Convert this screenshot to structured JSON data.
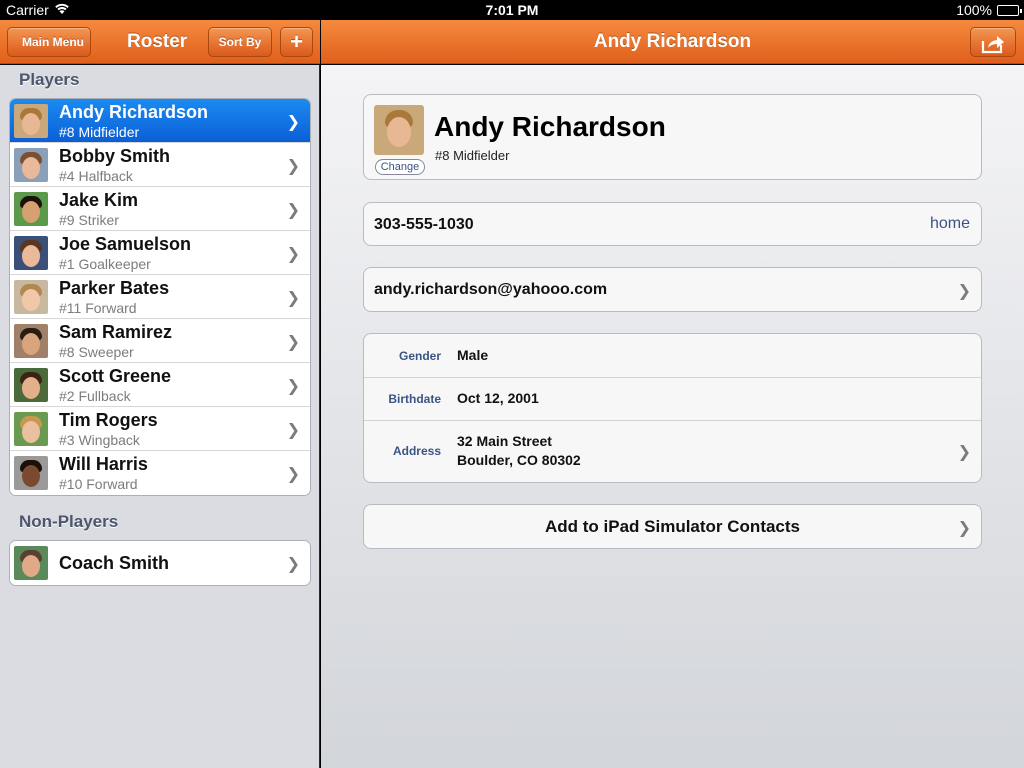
{
  "status_bar": {
    "carrier": "Carrier",
    "time": "7:01 PM",
    "battery": "100%"
  },
  "left_nav": {
    "back_label": "Main Menu",
    "title": "Roster",
    "sort_label": "Sort By",
    "add_label": "+"
  },
  "right_nav": {
    "title": "Andy Richardson",
    "share_icon": "share-icon"
  },
  "sidebar": {
    "players_header": "Players",
    "players": [
      {
        "name": "Andy Richardson",
        "detail": "#8 Midfielder",
        "selected": true,
        "skin": "#e8b895",
        "hair": "#a8793a",
        "bg": "#c9a87a"
      },
      {
        "name": "Bobby Smith",
        "detail": "#4 Halfback",
        "skin": "#eab99a",
        "hair": "#7a5030",
        "bg": "#8aa0b8"
      },
      {
        "name": "Jake Kim",
        "detail": "#9 Striker",
        "skin": "#d6a070",
        "hair": "#1c1208",
        "bg": "#5a9a4a"
      },
      {
        "name": "Joe Samuelson",
        "detail": "#1 Goalkeeper",
        "skin": "#eab99a",
        "hair": "#5a3620",
        "bg": "#3a5078"
      },
      {
        "name": "Parker Bates",
        "detail": "#11 Forward",
        "skin": "#f0c8a8",
        "hair": "#b08850",
        "bg": "#c8b8a0"
      },
      {
        "name": "Sam Ramirez",
        "detail": "#8 Sweeper",
        "skin": "#d8a47c",
        "hair": "#2a1c10",
        "bg": "#a08068"
      },
      {
        "name": "Scott Greene",
        "detail": "#2 Fullback",
        "skin": "#e4b08c",
        "hair": "#3a2414",
        "bg": "#4a6a3a"
      },
      {
        "name": "Tim Rogers",
        "detail": "#3 Wingback",
        "skin": "#eac0a0",
        "hair": "#c89850",
        "bg": "#6a9a50"
      },
      {
        "name": "Will Harris",
        "detail": "#10 Forward",
        "skin": "#7a4a30",
        "hair": "#1a1008",
        "bg": "#9a9a9a"
      }
    ],
    "non_players_header": "Non-Players",
    "non_players": [
      {
        "name": "Coach Smith",
        "skin": "#e0aa88",
        "hair": "#5a4030",
        "bg": "#5a8a5a"
      }
    ]
  },
  "detail": {
    "name": "Andy Richardson",
    "position": "#8 Midfielder",
    "change_label": "Change",
    "phone": "303-555-1030",
    "phone_label": "home",
    "email": "andy.richardson@yahooo.com",
    "info": [
      {
        "label": "Gender",
        "value": "Male"
      },
      {
        "label": "Birthdate",
        "value": "Oct 12, 2001"
      },
      {
        "label": "Address",
        "value_lines": [
          "32 Main Street",
          "Boulder, CO  80302"
        ]
      }
    ],
    "add_contacts_label": "Add to iPad Simulator Contacts"
  },
  "colors": {
    "nav_orange": "#e86d28",
    "selection_blue": "#0f6fe0",
    "label_blue": "#3b5484"
  }
}
